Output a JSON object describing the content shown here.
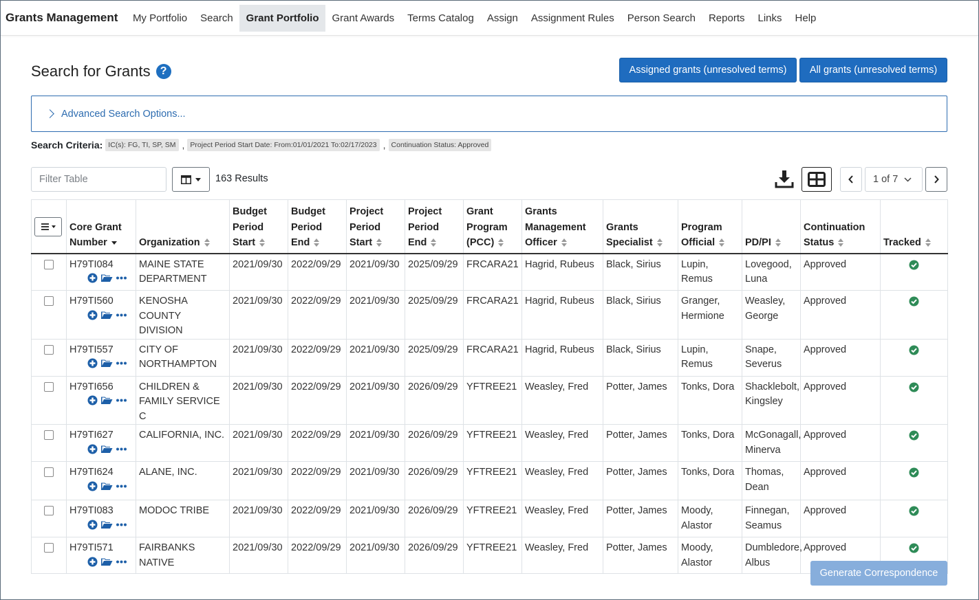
{
  "nav": {
    "brand": "Grants Management",
    "items": [
      "My Portfolio",
      "Search",
      "Grant Portfolio",
      "Grant Awards",
      "Terms Catalog",
      "Assign",
      "Assignment Rules",
      "Person Search",
      "Reports",
      "Links",
      "Help"
    ],
    "active": "Grant Portfolio"
  },
  "page": {
    "title": "Search for Grants",
    "btn_assigned": "Assigned grants (unresolved terms)",
    "btn_all": "All grants (unresolved terms)",
    "advanced": "Advanced Search Options..."
  },
  "criteria": {
    "label": "Search Criteria:",
    "chips": [
      "IC(s): FG, TI, SP, SM",
      "Project Period Start Date: From:01/01/2021 To:02/17/2023",
      "Continuation Status: Approved"
    ]
  },
  "toolbar": {
    "filter_placeholder": "Filter Table",
    "results": "163 Results",
    "page": "1 of 7"
  },
  "columns": [
    [
      "Core Grant",
      "Number"
    ],
    [
      "Organization"
    ],
    [
      "Budget",
      "Period",
      "Start"
    ],
    [
      "Budget",
      "Period",
      "End"
    ],
    [
      "Project",
      "Period",
      "Start"
    ],
    [
      "Project",
      "Period",
      "End"
    ],
    [
      "Grant",
      "Program",
      "(PCC)"
    ],
    [
      "Grants",
      "Management",
      "Officer"
    ],
    [
      "Grants",
      "Specialist"
    ],
    [
      "Program",
      "Official"
    ],
    [
      "PD/PI"
    ],
    [
      "Continuation",
      "Status"
    ],
    [
      "Tracked"
    ]
  ],
  "rows": [
    [
      "H79TI084",
      "MAINE STATE DEPARTMENT",
      "2021/09/30",
      "2022/09/29",
      "2021/09/30",
      "2025/09/29",
      "FRCARA21",
      "Hagrid, Rubeus",
      "Black, Sirius",
      "Lupin, Remus",
      "Lovegood, Luna",
      "Approved"
    ],
    [
      "H79TI560",
      "KENOSHA COUNTY DIVISION",
      "2021/09/30",
      "2022/09/29",
      "2021/09/30",
      "2025/09/29",
      "FRCARA21",
      "Hagrid, Rubeus",
      "Black, Sirius",
      "Granger, Hermione",
      "Weasley, George",
      "Approved"
    ],
    [
      "H79TI557",
      "CITY OF NORTHAMPTON",
      "2021/09/30",
      "2022/09/29",
      "2021/09/30",
      "2025/09/29",
      "FRCARA21",
      "Hagrid, Rubeus",
      "Black, Sirius",
      "Lupin, Remus",
      "Snape, Severus",
      "Approved"
    ],
    [
      "H79TI656",
      "CHILDREN & FAMILY SERVICE C",
      "2021/09/30",
      "2022/09/29",
      "2021/09/30",
      "2026/09/29",
      "YFTREE21",
      "Weasley, Fred",
      "Potter, James",
      "Tonks, Dora",
      "Shacklebolt, Kingsley",
      "Approved"
    ],
    [
      "H79TI627",
      "CALIFORNIA, INC.",
      "2021/09/30",
      "2022/09/29",
      "2021/09/30",
      "2026/09/29",
      "YFTREE21",
      "Weasley, Fred",
      "Potter, James",
      "Tonks, Dora",
      "McGonagall, Minerva",
      "Approved"
    ],
    [
      "H79TI624",
      "ALANE, INC.",
      "2021/09/30",
      "2022/09/29",
      "2021/09/30",
      "2026/09/29",
      "YFTREE21",
      "Weasley, Fred",
      "Potter, James",
      "Tonks, Dora",
      "Thomas, Dean",
      "Approved"
    ],
    [
      "H79TI083",
      "MODOC TRIBE",
      "2021/09/30",
      "2022/09/29",
      "2021/09/30",
      "2026/09/29",
      "YFTREE21",
      "Weasley, Fred",
      "Potter, James",
      "Moody, Alastor",
      "Finnegan, Seamus",
      "Approved"
    ],
    [
      "H79TI571",
      "FAIRBANKS NATIVE",
      "2021/09/30",
      "2022/09/29",
      "2021/09/30",
      "2026/09/29",
      "YFTREE21",
      "Weasley, Fred",
      "Potter, James",
      "Moody, Alastor",
      "Dumbledore, Albus",
      "Approved"
    ]
  ],
  "footer": {
    "generate": "Generate Correspondence"
  },
  "colors": {
    "primary": "#1f6cbf",
    "tracked_check": "#2e8b57",
    "disabled_btn": "#87aedc"
  }
}
